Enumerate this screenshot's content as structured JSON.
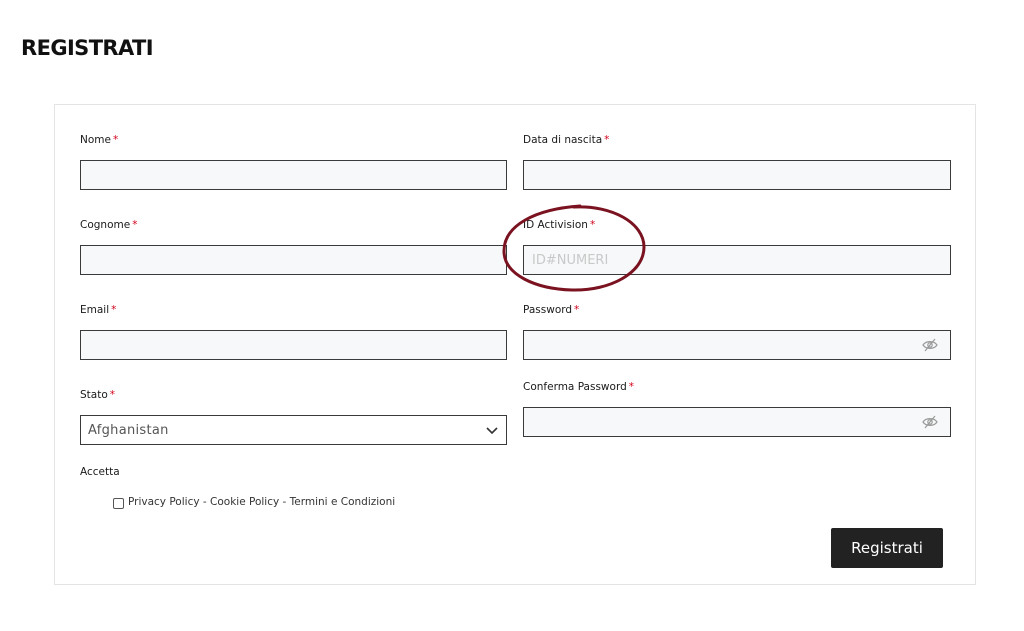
{
  "page": {
    "title": "REGISTRATI"
  },
  "form": {
    "fields": {
      "nome": {
        "label": "Nome",
        "required_mark": "*",
        "value": ""
      },
      "data_nascita": {
        "label": "Data di nascita",
        "required_mark": "*",
        "value": ""
      },
      "cognome": {
        "label": "Cognome",
        "required_mark": "*",
        "value": ""
      },
      "activision_id": {
        "label": "ID Activision",
        "required_mark": "*",
        "value": "",
        "placeholder": "ID#NUMERI"
      },
      "email": {
        "label": "Email",
        "required_mark": "*",
        "value": ""
      },
      "password": {
        "label": "Password",
        "required_mark": "*",
        "value": ""
      },
      "stato": {
        "label": "Stato",
        "required_mark": "*",
        "selected": "Afghanistan"
      },
      "conferma_password": {
        "label": "Conferma Password",
        "required_mark": "*",
        "value": ""
      }
    },
    "accept": {
      "label": "Accetta",
      "checkbox_label": "Privacy Policy - Cookie Policy - Termini e Condizioni",
      "checked": false
    },
    "submit_label": "Registrati"
  },
  "icons": {
    "password_toggle": "eye-slash-icon",
    "select_arrow": "chevron-down-icon"
  },
  "colors": {
    "required": "#d0021b",
    "button_bg": "#222222",
    "input_bg": "#f7f8fa",
    "annotation": "#7a1220"
  }
}
